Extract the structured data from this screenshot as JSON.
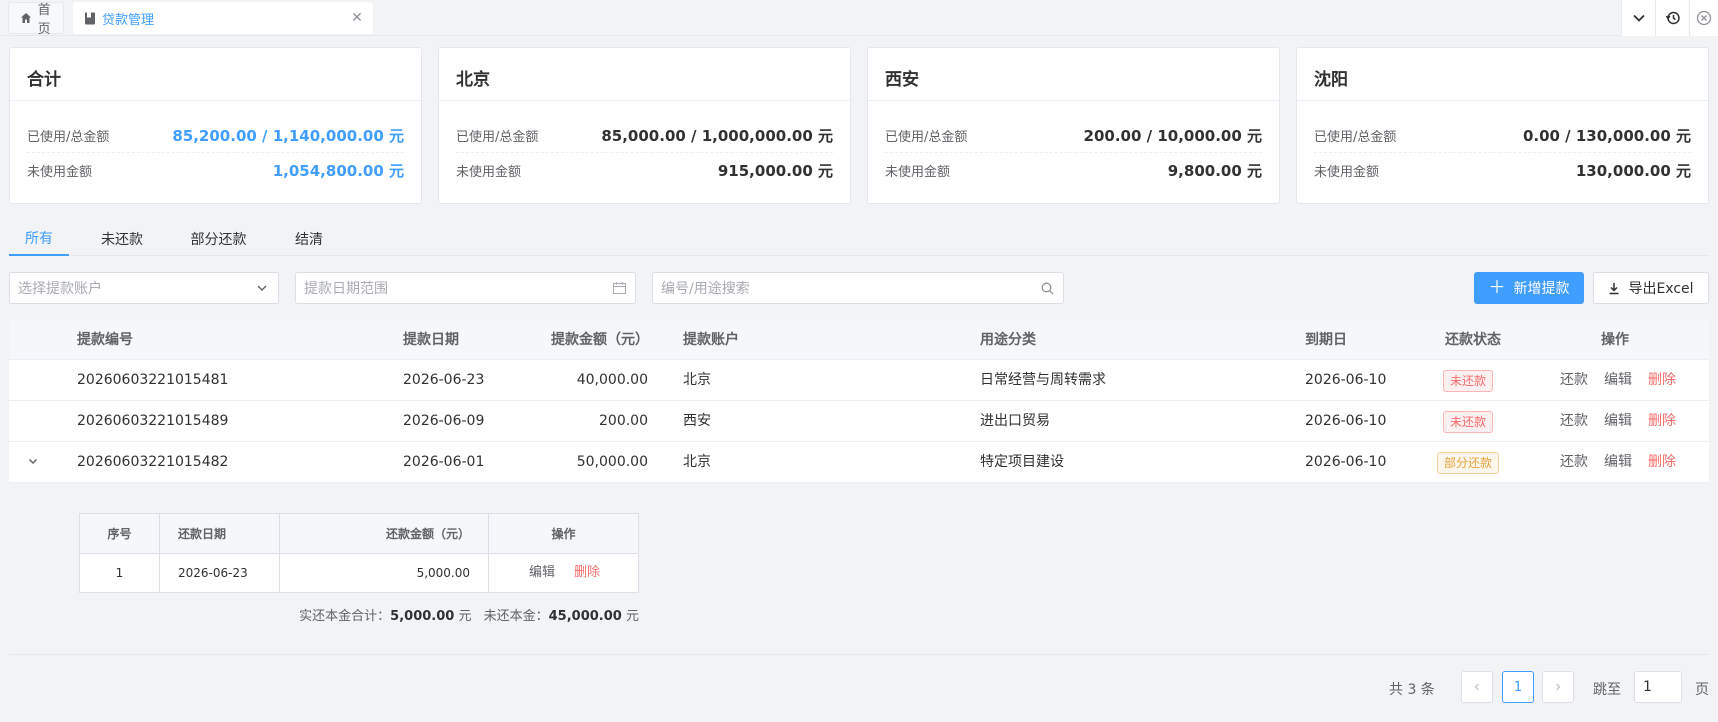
{
  "tabs": {
    "home": "首页",
    "loan": "贷款管理"
  },
  "cards": [
    {
      "title": "合计",
      "used_label": "已使用/总金额",
      "used_value": "85,200.00 / 1,140,000.00 元",
      "unused_label": "未使用金额",
      "unused_value": "1,054,800.00 元",
      "accent": "#409eff"
    },
    {
      "title": "北京",
      "used_label": "已使用/总金额",
      "used_value": "85,000.00 / 1,000,000.00 元",
      "unused_label": "未使用金额",
      "unused_value": "915,000.00 元"
    },
    {
      "title": "西安",
      "used_label": "已使用/总金额",
      "used_value": "200.00 / 10,000.00 元",
      "unused_label": "未使用金额",
      "unused_value": "9,800.00 元"
    },
    {
      "title": "沈阳",
      "used_label": "已使用/总金额",
      "used_value": "0.00 / 130,000.00 元",
      "unused_label": "未使用金额",
      "unused_value": "130,000.00 元"
    }
  ],
  "status_tabs": [
    "所有",
    "未还款",
    "部分还款",
    "结清"
  ],
  "filters": {
    "account_placeholder": "选择提款账户",
    "date_placeholder": "提款日期范围",
    "search_placeholder": "编号/用途搜索"
  },
  "actions": {
    "add": "新增提款",
    "export": "导出Excel"
  },
  "table": {
    "headers": [
      "提款编号",
      "提款日期",
      "提款金额（元）",
      "提款账户",
      "用途分类",
      "到期日",
      "还款状态",
      "操作"
    ],
    "rows": [
      {
        "id": "20260603221015481",
        "date": "2026-06-23",
        "amount": "40,000.00",
        "account": "北京",
        "purpose": "日常经营与周转需求",
        "due": "2026-06-10",
        "status": "未还款",
        "ops": [
          "还款",
          "编辑",
          "删除"
        ]
      },
      {
        "id": "20260603221015489",
        "date": "2026-06-09",
        "amount": "200.00",
        "account": "西安",
        "purpose": "进出口贸易",
        "due": "2026-06-10",
        "status": "未还款",
        "ops": [
          "还款",
          "编辑",
          "删除"
        ]
      },
      {
        "id": "20260603221015482",
        "date": "2026-06-01",
        "amount": "50,000.00",
        "account": "北京",
        "purpose": "特定项目建设",
        "due": "2026-06-10",
        "status": "部分还款",
        "ops": [
          "还款",
          "编辑",
          "删除"
        ]
      }
    ]
  },
  "repayments": {
    "headers": [
      "序号",
      "还款日期",
      "还款金额（元）",
      "操作"
    ],
    "rows": [
      {
        "no": "1",
        "date": "2026-06-23",
        "amount": "5,000.00",
        "ops": [
          "编辑",
          "删除"
        ]
      }
    ],
    "paid_label": "实还本金合计：",
    "paid_value": "5,000.00",
    "paid_unit": "元",
    "unpaid_label": "未还本金：",
    "unpaid_value": "45,000.00",
    "unpaid_unit": "元"
  },
  "pagination": {
    "total": "共 3 条",
    "current": "1",
    "jump_label": "跳至",
    "jump_value": "1",
    "page_label": "页"
  }
}
